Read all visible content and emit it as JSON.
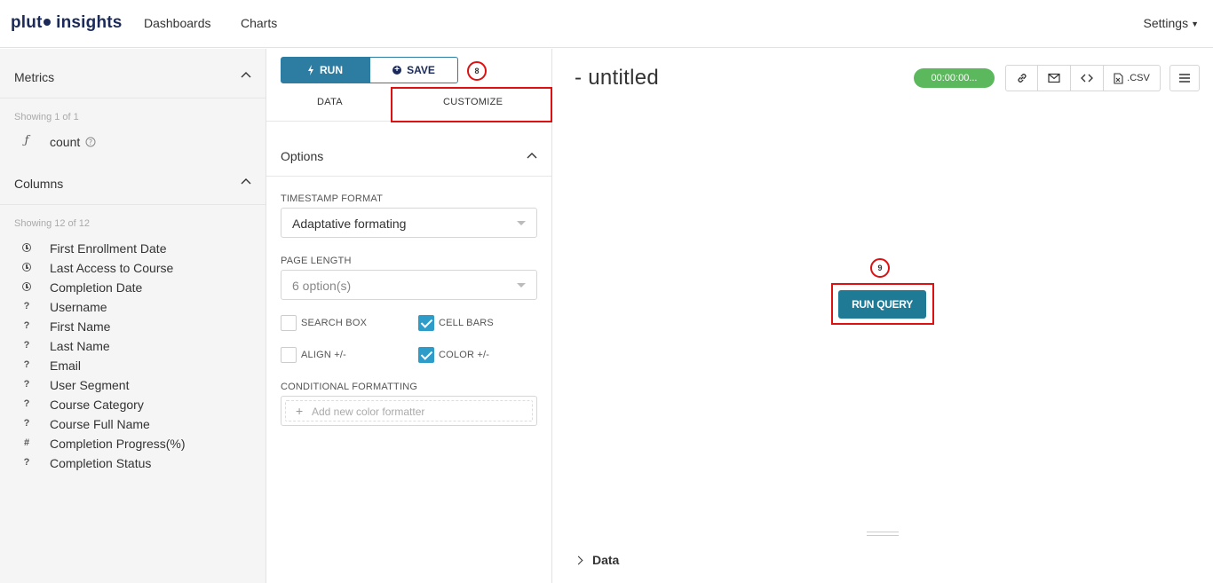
{
  "nav": {
    "brand_part1": "plut",
    "brand_part2": "insights",
    "links": [
      "Dashboards",
      "Charts"
    ],
    "settings_label": "Settings"
  },
  "sidebar": {
    "metrics_title": "Metrics",
    "metrics_showing": "Showing 1 of 1",
    "metrics": [
      {
        "icon": "function-icon",
        "glyph": "ƒ",
        "label": "count"
      }
    ],
    "columns_title": "Columns",
    "columns_showing": "Showing 12 of 12",
    "columns": [
      {
        "icon": "clock-icon",
        "label": "First Enrollment Date"
      },
      {
        "icon": "clock-icon",
        "label": "Last Access to Course"
      },
      {
        "icon": "clock-icon",
        "label": "Completion Date"
      },
      {
        "icon": "question-icon",
        "glyph": "?",
        "label": "Username"
      },
      {
        "icon": "question-icon",
        "glyph": "?",
        "label": "First Name"
      },
      {
        "icon": "question-icon",
        "glyph": "?",
        "label": "Last Name"
      },
      {
        "icon": "question-icon",
        "glyph": "?",
        "label": "Email"
      },
      {
        "icon": "question-icon",
        "glyph": "?",
        "label": "User Segment"
      },
      {
        "icon": "question-icon",
        "glyph": "?",
        "label": "Course Category"
      },
      {
        "icon": "question-icon",
        "glyph": "?",
        "label": "Course Full Name"
      },
      {
        "icon": "hash-icon",
        "glyph": "#",
        "label": "Completion Progress(%)"
      },
      {
        "icon": "question-icon",
        "glyph": "?",
        "label": "Completion Status"
      }
    ]
  },
  "middle": {
    "run_label": "RUN",
    "save_label": "SAVE",
    "step_badge_8": "8",
    "tab_data": "DATA",
    "tab_customize": "CUSTOMIZE",
    "options_title": "Options",
    "timestamp_label": "TIMESTAMP FORMAT",
    "timestamp_value": "Adaptative formating",
    "page_length_label": "PAGE LENGTH",
    "page_length_value": "6 option(s)",
    "checkboxes": {
      "search_box": {
        "label": "SEARCH BOX",
        "checked": false
      },
      "cell_bars": {
        "label": "CELL BARS",
        "checked": true
      },
      "align": {
        "label": "ALIGN +/-",
        "checked": false
      },
      "color": {
        "label": "COLOR +/-",
        "checked": true
      }
    },
    "conditional_label": "CONDITIONAL FORMATTING",
    "add_formatter": "Add new color formatter"
  },
  "main": {
    "title": "- untitled",
    "timer": "00:00:00...",
    "csv_label": ".CSV",
    "step_badge_9": "9",
    "run_query_label": "RUN QUERY",
    "data_section": "Data"
  },
  "colors": {
    "brand": "#1b2a59",
    "primary": "#2d7da3",
    "run_query": "#1f7a96",
    "timer": "#5cb85c",
    "checkbox": "#2d9cc9",
    "annotation": "#dd1111"
  }
}
